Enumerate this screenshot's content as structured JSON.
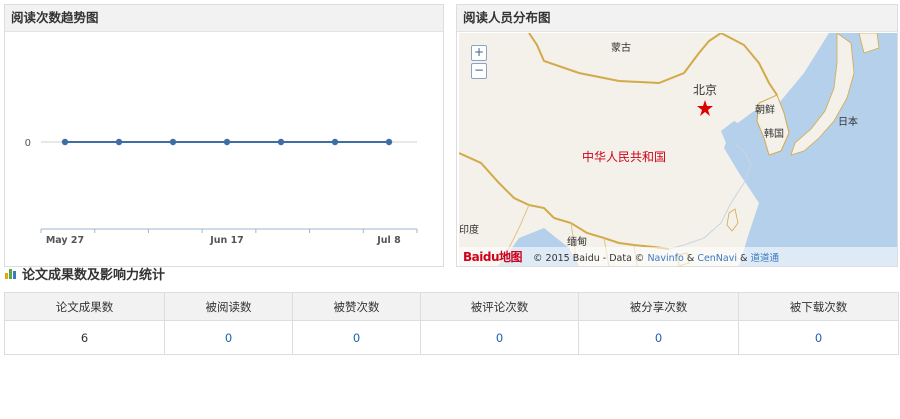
{
  "trend_panel": {
    "title": "阅读次数趋势图"
  },
  "chart_data": {
    "type": "line",
    "x_tick_labels": [
      "May 27",
      "Jun 17",
      "Jul 8"
    ],
    "series": [
      {
        "values": [
          0,
          0,
          0,
          0,
          0,
          0,
          0
        ]
      }
    ],
    "y_tick_labels": [
      "0"
    ],
    "title": "",
    "xlabel": "",
    "ylabel": "",
    "color": "#3f6ea5",
    "grid": true
  },
  "map_panel": {
    "title": "阅读人员分布图",
    "zoom_in": "+",
    "zoom_out": "−",
    "labels": {
      "mongolia": "蒙古",
      "beijing": "北京",
      "korea_north": "朝鲜",
      "korea_south": "韩国",
      "japan": "日本",
      "china": "中华人民共和国",
      "india": "印度",
      "myanmar": "缅甸"
    },
    "logo_text": "Baidu地图",
    "copyright_prefix": "© 2015 Baidu - Data ©",
    "links": [
      "Navinfo",
      "CenNavi",
      "道道通"
    ],
    "amp": "&",
    "colors": {
      "sea": "#b5d0ea",
      "land": "#f3f1e9",
      "border": "#d4a94a",
      "china_label": "#d0021b",
      "beijing_star": "#e00000"
    }
  },
  "stats": {
    "title": "论文成果数及影响力统计",
    "headers": [
      "论文成果数",
      "被阅读数",
      "被赞次数",
      "被评论次数",
      "被分享次数",
      "被下载次数"
    ],
    "values": [
      "6",
      "0",
      "0",
      "0",
      "0",
      "0"
    ],
    "link_color": "#1a5fb4"
  }
}
